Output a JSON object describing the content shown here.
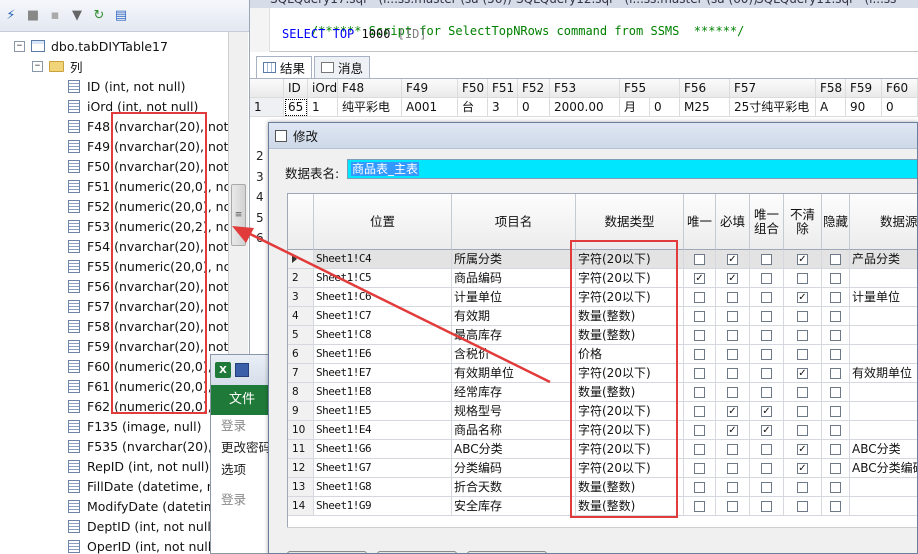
{
  "explorer": {
    "tree": {
      "table": "dbo.tabDIYTable17",
      "folder": "列",
      "columns": [
        "ID (int, not null)",
        "iOrd (int, not null)",
        "F48 (nvarchar(20), not n",
        "F49 (nvarchar(20), not n",
        "F50 (nvarchar(20), not n",
        "F51 (numeric(20,0), not",
        "F52 (numeric(20,0), not",
        "F53 (numeric(20,2), not",
        "F54 (nvarchar(20), not n",
        "F55 (numeric(20,0), not",
        "F56 (nvarchar(20), not n",
        "F57 (nvarchar(20), not n",
        "F58 (nvarchar(20), not n",
        "F59 (nvarchar(20), not n",
        "F60 (numeric(20,0), n",
        "F61 (numeric(20,0), n",
        "F62 (numeric(20,0), n",
        "F135 (image, null)",
        "F535 (nvarchar(20), n",
        "RepID (int, not null)",
        "FillDate (datetime, no",
        "ModifyDate (datetim",
        "DeptID (int, not null)",
        "OperID (int, not null)"
      ]
    }
  },
  "editor": {
    "doc_tabs": [
      "SQLQuery17.sql - (l...ss.master (sa (56))",
      "SQLQuery12.sql - (l...ss.master (sa (60))",
      "SQLQuery11.sql - (l...ss"
    ],
    "line1": "/****** Script for SelectTopNRows command from SSMS  ******/",
    "line2_kw1": "SELECT",
    "line2_kw2": "TOP",
    "line2_num": "1000",
    "line2_id": "[ID]"
  },
  "results": {
    "tabs": [
      {
        "label": "结果"
      },
      {
        "label": "消息"
      }
    ],
    "headers": [
      "ID",
      "iOrd",
      "F48",
      "F49",
      "F50",
      "F51",
      "F52",
      "F53",
      "F55",
      "F56",
      "F57",
      "F58",
      "F59",
      "F60"
    ],
    "row1": [
      "1",
      "65",
      "1",
      "纯平彩电",
      "A001",
      "台",
      "3",
      "0",
      "2000.00",
      "月",
      "0",
      "M25",
      "25寸纯平彩电",
      "A",
      "90",
      "0"
    ],
    "ghost_rows": [
      "2",
      "3",
      "4",
      "5",
      "6"
    ]
  },
  "excel": {
    "logo": "X",
    "file_tab": "文件",
    "items": [
      "登录",
      "更改密码",
      "选项",
      "登录"
    ]
  },
  "dialog": {
    "title": "修改",
    "form_label": "数据表名:",
    "form_value": "商品表_主表",
    "headers": [
      "位置",
      "项目名",
      "数据类型",
      "唯一",
      "必填",
      "唯一\n组合",
      "不清除",
      "隐藏",
      "数据源"
    ],
    "rows": [
      {
        "n": "1",
        "loc": "Sheet1!C4",
        "name": "所属分类",
        "type": "字符(20以下)",
        "u": false,
        "r": true,
        "uc": false,
        "nc": true,
        "h": false,
        "src": "产品分类"
      },
      {
        "n": "2",
        "loc": "Sheet1!C5",
        "name": "商品编码",
        "type": "字符(20以下)",
        "u": true,
        "r": true,
        "uc": false,
        "nc": false,
        "h": false,
        "src": ""
      },
      {
        "n": "3",
        "loc": "Sheet1!C6",
        "name": "计量单位",
        "type": "字符(20以下)",
        "u": false,
        "r": false,
        "uc": false,
        "nc": true,
        "h": false,
        "src": "计量单位"
      },
      {
        "n": "4",
        "loc": "Sheet1!C7",
        "name": "有效期",
        "type": "数量(整数)",
        "u": false,
        "r": false,
        "uc": false,
        "nc": false,
        "h": false,
        "src": ""
      },
      {
        "n": "5",
        "loc": "Sheet1!C8",
        "name": "最高库存",
        "type": "数量(整数)",
        "u": false,
        "r": false,
        "uc": false,
        "nc": false,
        "h": false,
        "src": ""
      },
      {
        "n": "6",
        "loc": "Sheet1!E6",
        "name": "含税价",
        "type": "价格",
        "u": false,
        "r": false,
        "uc": false,
        "nc": false,
        "h": false,
        "src": ""
      },
      {
        "n": "7",
        "loc": "Sheet1!E7",
        "name": "有效期单位",
        "type": "字符(20以下)",
        "u": false,
        "r": false,
        "uc": false,
        "nc": true,
        "h": false,
        "src": "有效期单位"
      },
      {
        "n": "8",
        "loc": "Sheet1!E8",
        "name": "经常库存",
        "type": "数量(整数)",
        "u": false,
        "r": false,
        "uc": false,
        "nc": false,
        "h": false,
        "src": ""
      },
      {
        "n": "9",
        "loc": "Sheet1!E5",
        "name": "规格型号",
        "type": "字符(20以下)",
        "u": false,
        "r": true,
        "uc": true,
        "nc": false,
        "h": false,
        "src": ""
      },
      {
        "n": "10",
        "loc": "Sheet1!E4",
        "name": "商品名称",
        "type": "字符(20以下)",
        "u": false,
        "r": true,
        "uc": true,
        "nc": false,
        "h": false,
        "src": ""
      },
      {
        "n": "11",
        "loc": "Sheet1!G6",
        "name": "ABC分类",
        "type": "字符(20以下)",
        "u": false,
        "r": false,
        "uc": false,
        "nc": true,
        "h": false,
        "src": "ABC分类"
      },
      {
        "n": "12",
        "loc": "Sheet1!G7",
        "name": "分类编码",
        "type": "字符(20以下)",
        "u": false,
        "r": false,
        "uc": false,
        "nc": true,
        "h": false,
        "src": "ABC分类编码"
      },
      {
        "n": "13",
        "loc": "Sheet1!G8",
        "name": "折合天数",
        "type": "数量(整数)",
        "u": false,
        "r": false,
        "uc": false,
        "nc": false,
        "h": false,
        "src": ""
      },
      {
        "n": "14",
        "loc": "Sheet1!G9",
        "name": "安全库存",
        "type": "数量(整数)",
        "u": false,
        "r": false,
        "uc": false,
        "nc": false,
        "h": false,
        "src": ""
      }
    ]
  },
  "checkmark": "✓",
  "colors": {
    "annotation_red": "#e23b3b",
    "highlight_cyan": "#00e6ff",
    "selection_blue": "#3399ff"
  }
}
